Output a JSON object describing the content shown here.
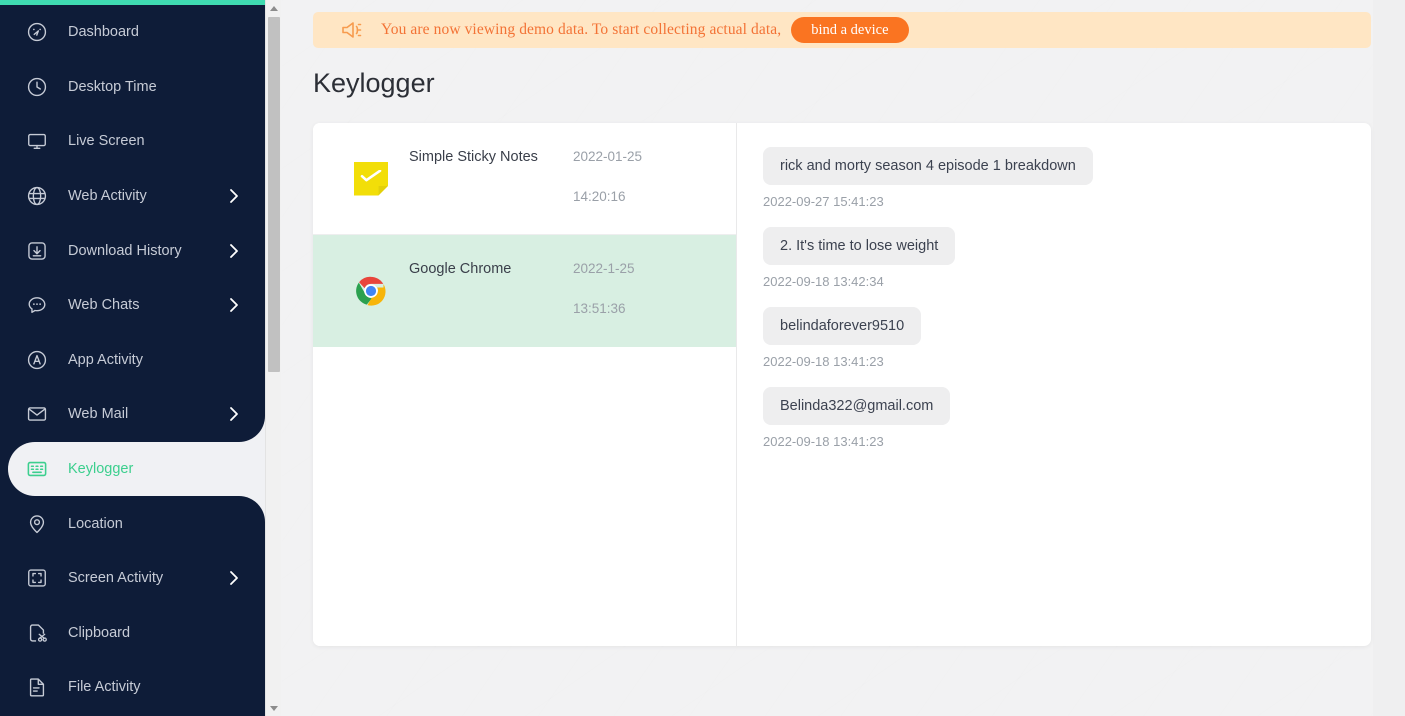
{
  "sidebar": {
    "accent_color": "#3fdbb1",
    "background_color": "#0e1c38",
    "active_color": "#3ccf8e",
    "items": [
      {
        "label": "Dashboard",
        "icon": "dashboard-icon",
        "caret": false,
        "active": false
      },
      {
        "label": "Desktop Time",
        "icon": "clock-icon",
        "caret": false,
        "active": false
      },
      {
        "label": "Live Screen",
        "icon": "monitor-icon",
        "caret": false,
        "active": false
      },
      {
        "label": "Web Activity",
        "icon": "globe-icon",
        "caret": true,
        "active": false
      },
      {
        "label": "Download History",
        "icon": "download-icon",
        "caret": true,
        "active": false
      },
      {
        "label": "Web Chats",
        "icon": "chat-bubble-icon",
        "caret": true,
        "active": false
      },
      {
        "label": "App Activity",
        "icon": "app-circle-a-icon",
        "caret": false,
        "active": false
      },
      {
        "label": "Web Mail",
        "icon": "envelope-icon",
        "caret": true,
        "active": false
      },
      {
        "label": "Keylogger",
        "icon": "keyboard-icon",
        "caret": false,
        "active": true
      },
      {
        "label": "Location",
        "icon": "map-pin-icon",
        "caret": false,
        "active": false
      },
      {
        "label": "Screen Activity",
        "icon": "screenshot-frame-icon",
        "caret": true,
        "active": false
      },
      {
        "label": "Clipboard",
        "icon": "clipboard-scissors-icon",
        "caret": false,
        "active": false
      },
      {
        "label": "File Activity",
        "icon": "file-lines-icon",
        "caret": false,
        "active": false
      }
    ]
  },
  "banner": {
    "icon": "megaphone-icon",
    "text": "You are now viewing demo data. To start collecting actual data,",
    "button_label": "bind a device",
    "background_color": "#ffe6c4",
    "text_color": "#f37336",
    "button_color": "#fa7421"
  },
  "page": {
    "title": "Keylogger"
  },
  "app_list": {
    "selected_row_color": "#d8efe2",
    "rows": [
      {
        "name": "Simple Sticky Notes",
        "date": "2022-01-25",
        "time": "14:20:16",
        "icon": "sticky-note-icon",
        "selected": false
      },
      {
        "name": "Google Chrome",
        "date": "2022-1-25",
        "time": "13:51:36",
        "icon": "chrome-icon",
        "selected": true
      }
    ]
  },
  "detail": {
    "entries": [
      {
        "text": "rick and morty season 4 episode 1 breakdown",
        "timestamp": "2022-09-27 15:41:23"
      },
      {
        "text": "2. It's time to lose weight",
        "timestamp": "2022-09-18 13:42:34"
      },
      {
        "text": "belindaforever9510",
        "timestamp": "2022-09-18 13:41:23"
      },
      {
        "text": "Belinda322@gmail.com",
        "timestamp": "2022-09-18 13:41:23"
      }
    ]
  },
  "scrollbar": {
    "up_arrow": "triangle-up-icon",
    "down_arrow": "triangle-down-icon"
  }
}
